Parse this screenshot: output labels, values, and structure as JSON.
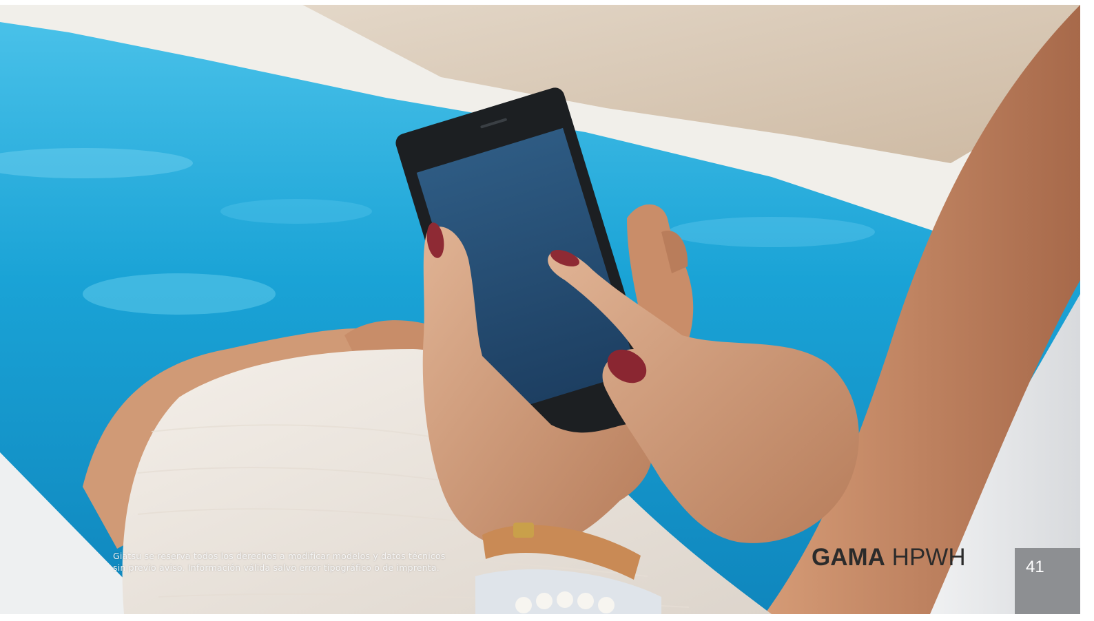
{
  "footer": {
    "disclaimer_line1": "Giatsu se reserva todos los derechos a modificar modelos y datos técnicos",
    "disclaimer_line2": "sin previo aviso. Información válida salvo error tipográfico o de imprenta.",
    "series_bold": "GAMA",
    "series_regular": "HPWH",
    "page_number": "41"
  },
  "colors": {
    "pool_blue": "#1aa3d6",
    "page_number_box": "#8d8f92",
    "title_text": "#2b2b2b"
  }
}
